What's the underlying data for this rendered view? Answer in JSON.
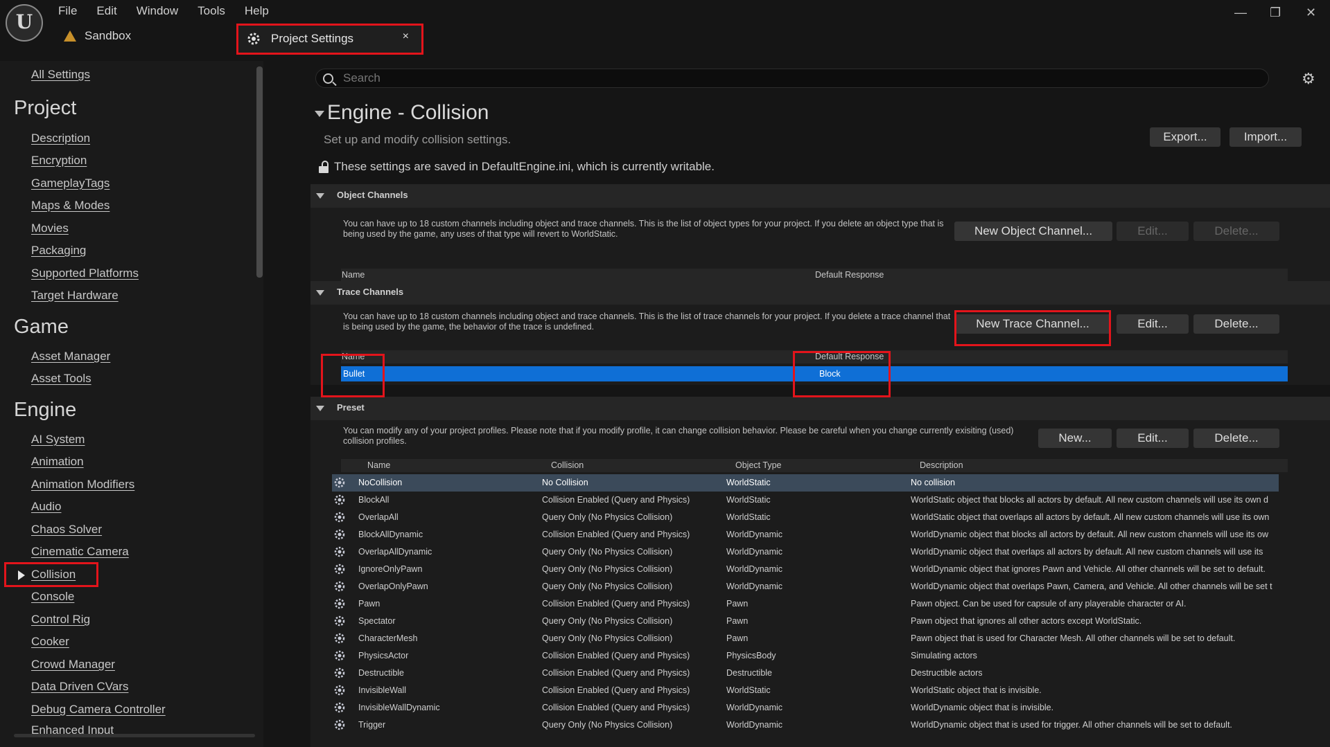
{
  "menu": [
    "File",
    "Edit",
    "Window",
    "Tools",
    "Help"
  ],
  "project_name": "Sandbox",
  "tab": {
    "label": "Project Settings",
    "close": "×"
  },
  "window_controls": {
    "minimize": "—",
    "restore": "❐",
    "close": "✕"
  },
  "sidebar": {
    "all_settings": "All Settings",
    "sections": [
      {
        "heading": "Project",
        "items": [
          "Description",
          "Encryption",
          "GameplayTags",
          "Maps & Modes",
          "Movies",
          "Packaging",
          "Supported Platforms",
          "Target Hardware"
        ]
      },
      {
        "heading": "Game",
        "items": [
          "Asset Manager",
          "Asset Tools"
        ]
      },
      {
        "heading": "Engine",
        "items": [
          "AI System",
          "Animation",
          "Animation Modifiers",
          "Audio",
          "Chaos Solver",
          "Cinematic Camera",
          "Collision",
          "Console",
          "Control Rig",
          "Cooker",
          "Crowd Manager",
          "Data Driven CVars",
          "Debug Camera Controller",
          "Enhanced Input"
        ]
      }
    ],
    "selected": "Collision"
  },
  "search": {
    "placeholder": "Search"
  },
  "page": {
    "title": "Engine - Collision",
    "subtitle": "Set up and modify collision settings.",
    "export": "Export...",
    "import": "Import...",
    "writable_note": "These settings are saved in DefaultEngine.ini, which is currently writable."
  },
  "object_channels": {
    "header": "Object Channels",
    "description": "You can have up to 18 custom channels including object and trace channels. This is the list of object types for your project. If you delete an object type that is being used by the game, any uses of that type will revert to WorldStatic.",
    "buttons": {
      "new": "New Object Channel...",
      "edit": "Edit...",
      "delete": "Delete..."
    },
    "columns": {
      "name": "Name",
      "response": "Default Response"
    }
  },
  "trace_channels": {
    "header": "Trace Channels",
    "description": "You can have up to 18 custom channels including object and trace channels. This is the list of trace channels for your project. If you delete a trace channel that is being used by the game, the behavior of the trace is undefined.",
    "buttons": {
      "new": "New Trace Channel...",
      "edit": "Edit...",
      "delete": "Delete..."
    },
    "columns": {
      "name": "Name",
      "response": "Default Response"
    },
    "rows": [
      {
        "name": "Bullet",
        "response": "Block"
      }
    ]
  },
  "preset": {
    "header": "Preset",
    "description": "You can modify any of your project profiles. Please note that if you modify profile, it can change collision behavior. Please be careful when you change currently exisiting (used) collision profiles.",
    "buttons": {
      "new": "New...",
      "edit": "Edit...",
      "delete": "Delete..."
    },
    "columns": {
      "name": "Name",
      "collision": "Collision",
      "object_type": "Object Type",
      "description": "Description"
    },
    "rows": [
      {
        "name": "NoCollision",
        "collision": "No Collision",
        "type": "WorldStatic",
        "desc": "No collision"
      },
      {
        "name": "BlockAll",
        "collision": "Collision Enabled (Query and Physics)",
        "type": "WorldStatic",
        "desc": "WorldStatic object that blocks all actors by default. All new custom channels will use its own d"
      },
      {
        "name": "OverlapAll",
        "collision": "Query Only (No Physics Collision)",
        "type": "WorldStatic",
        "desc": "WorldStatic object that overlaps all actors by default. All new custom channels will use its own"
      },
      {
        "name": "BlockAllDynamic",
        "collision": "Collision Enabled (Query and Physics)",
        "type": "WorldDynamic",
        "desc": "WorldDynamic object that blocks all actors by default. All new custom channels will use its ow"
      },
      {
        "name": "OverlapAllDynamic",
        "collision": "Query Only (No Physics Collision)",
        "type": "WorldDynamic",
        "desc": "WorldDynamic object that overlaps all actors by default. All new custom channels will use its"
      },
      {
        "name": "IgnoreOnlyPawn",
        "collision": "Query Only (No Physics Collision)",
        "type": "WorldDynamic",
        "desc": "WorldDynamic object that ignores Pawn and Vehicle. All other channels will be set to default."
      },
      {
        "name": "OverlapOnlyPawn",
        "collision": "Query Only (No Physics Collision)",
        "type": "WorldDynamic",
        "desc": "WorldDynamic object that overlaps Pawn, Camera, and Vehicle. All other channels will be set t"
      },
      {
        "name": "Pawn",
        "collision": "Collision Enabled (Query and Physics)",
        "type": "Pawn",
        "desc": "Pawn object. Can be used for capsule of any playerable character or AI."
      },
      {
        "name": "Spectator",
        "collision": "Query Only (No Physics Collision)",
        "type": "Pawn",
        "desc": "Pawn object that ignores all other actors except WorldStatic."
      },
      {
        "name": "CharacterMesh",
        "collision": "Query Only (No Physics Collision)",
        "type": "Pawn",
        "desc": "Pawn object that is used for Character Mesh. All other channels will be set to default."
      },
      {
        "name": "PhysicsActor",
        "collision": "Collision Enabled (Query and Physics)",
        "type": "PhysicsBody",
        "desc": "Simulating actors"
      },
      {
        "name": "Destructible",
        "collision": "Collision Enabled (Query and Physics)",
        "type": "Destructible",
        "desc": "Destructible actors"
      },
      {
        "name": "InvisibleWall",
        "collision": "Collision Enabled (Query and Physics)",
        "type": "WorldStatic",
        "desc": "WorldStatic object that is invisible."
      },
      {
        "name": "InvisibleWallDynamic",
        "collision": "Collision Enabled (Query and Physics)",
        "type": "WorldDynamic",
        "desc": "WorldDynamic object that is invisible."
      },
      {
        "name": "Trigger",
        "collision": "Query Only (No Physics Collision)",
        "type": "WorldDynamic",
        "desc": "WorldDynamic object that is used for trigger. All other channels will be set to default."
      }
    ]
  },
  "colors": {
    "highlight": "#e3141b",
    "selection": "#0f6fd6",
    "preset_selected": "#3b4a5a"
  }
}
